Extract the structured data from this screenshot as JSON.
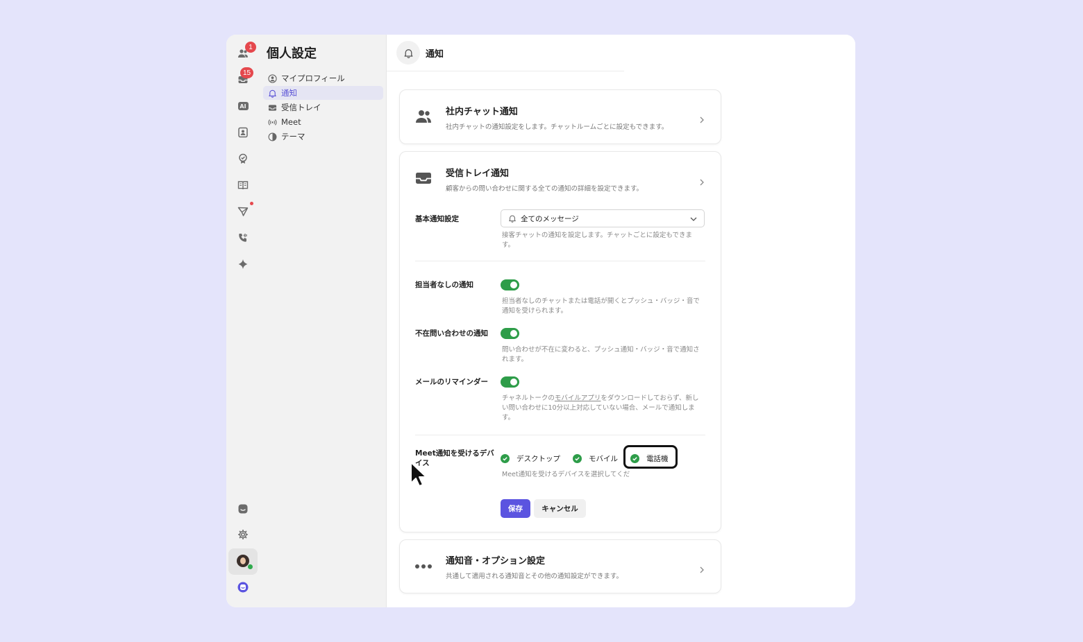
{
  "rail": {
    "badges": {
      "team_chat": "1",
      "inbox": "15"
    },
    "ai_label": "AI"
  },
  "nav": {
    "title": "個人設定",
    "items": [
      {
        "label": "マイプロフィール",
        "icon": "user-circle-icon"
      },
      {
        "label": "通知",
        "icon": "bell-icon",
        "active": true
      },
      {
        "label": "受信トレイ",
        "icon": "inbox-icon"
      },
      {
        "label": "Meet",
        "icon": "broadcast-icon"
      },
      {
        "label": "テーマ",
        "icon": "theme-icon"
      }
    ]
  },
  "header": {
    "title": "通知"
  },
  "cards": {
    "team_chat": {
      "title": "社内チャット通知",
      "desc": "社内チャットの通知設定をします。チャットルームごとに設定もできます。"
    },
    "inbox": {
      "title": "受信トレイ通知",
      "desc": "顧客からの問い合わせに関する全ての通知の詳細を設定できます。",
      "basic": {
        "label": "基本通知設定",
        "value": "全てのメッセージ",
        "help": "接客チャットの通知を設定します。チャットごとに設定もできます。"
      },
      "unassigned": {
        "label": "担当者なしの通知",
        "on": true,
        "help": "担当者なしのチャットまたは電話が開くとプッシュ・バッジ・音で通知を受けられます。"
      },
      "away": {
        "label": "不在問い合わせの通知",
        "on": true,
        "help": "問い合わせが不在に変わると、プッシュ通知・バッジ・音で通知されます。"
      },
      "email": {
        "label": "メールのリマインダー",
        "on": true,
        "help_pre": "チャネルトークの",
        "help_link": "モバイルアプリ",
        "help_post": "をダウンロードしておらず、新しい問い合わせに10分以上対応していない場合、メールで通知します。"
      },
      "meet": {
        "label": "Meet通知を受けるデバイス",
        "options": [
          {
            "label": "デスクトップ",
            "checked": true
          },
          {
            "label": "モバイル",
            "checked": true
          },
          {
            "label": "電話機",
            "checked": true
          }
        ],
        "help": "Meet通知を受けるデバイスを選択してくだ"
      },
      "save_label": "保存",
      "cancel_label": "キャンセル"
    },
    "sound": {
      "title": "通知音・オプション設定",
      "desc": "共通して適用される通知音とその他の通知設定ができます。"
    }
  },
  "colors": {
    "accent": "#5b54e0",
    "toggle_on": "#2e9d49",
    "badge": "#e5484d",
    "background": "#e4e4fb"
  }
}
